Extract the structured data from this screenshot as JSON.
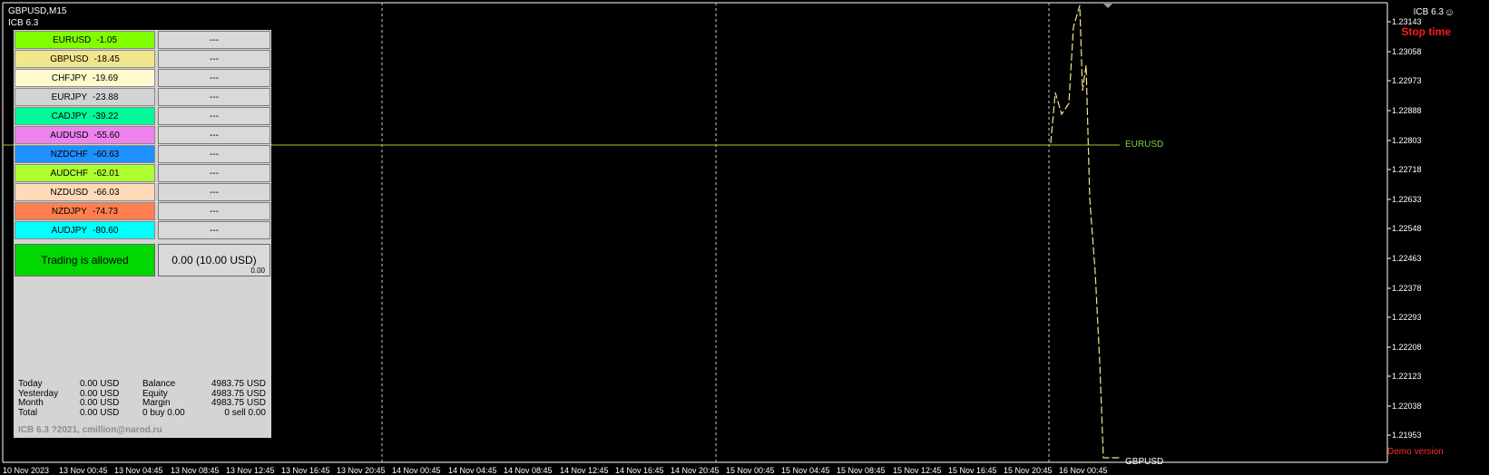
{
  "window": {
    "title": "GBPUSD,M15",
    "indicator": "ICB 6.3",
    "indicator_right": "ICB 6.3",
    "smile_icon": "smiley-icon"
  },
  "status": {
    "stop_time": "Stop time",
    "demo": "Demo version"
  },
  "pairs": [
    {
      "symbol": "EURUSD",
      "value": "-1.05",
      "color": "#80ff00",
      "action": "---"
    },
    {
      "symbol": "GBPUSD",
      "value": "-18.45",
      "color": "#f0e68c",
      "action": "---"
    },
    {
      "symbol": "CHFJPY",
      "value": "-19.69",
      "color": "#fffacd",
      "action": "---"
    },
    {
      "symbol": "EURJPY",
      "value": "-23.88",
      "color": "#d3d3d3",
      "action": "---"
    },
    {
      "symbol": "CADJPY",
      "value": "-39.22",
      "color": "#00fa9a",
      "action": "---"
    },
    {
      "symbol": "AUDUSD",
      "value": "-55.60",
      "color": "#ee82ee",
      "action": "---"
    },
    {
      "symbol": "NZDCHF",
      "value": "-60.63",
      "color": "#1e90ff",
      "action": "---"
    },
    {
      "symbol": "AUDCHF",
      "value": "-62.01",
      "color": "#adff2f",
      "action": "---"
    },
    {
      "symbol": "NZDUSD",
      "value": "-66.03",
      "color": "#ffdab9",
      "action": "---"
    },
    {
      "symbol": "NZDJPY",
      "value": "-74.73",
      "color": "#ff7f50",
      "action": "---"
    },
    {
      "symbol": "AUDJPY",
      "value": "-80.60",
      "color": "#00ffff",
      "action": "---"
    }
  ],
  "trading": {
    "status": "Trading is allowed",
    "profit": "0.00 (10.00 USD)",
    "profit_small": "0.00"
  },
  "stats": {
    "today_label": "Today",
    "today": "0.00 USD",
    "yesterday_label": "Yesterday",
    "yesterday": "0.00 USD",
    "month_label": "Month",
    "month": "0.00 USD",
    "total_label": "Total",
    "total": "0.00 USD",
    "balance_label": "Balance",
    "balance": "4983.75 USD",
    "equity_label": "Equity",
    "equity": "4983.75 USD",
    "margin_label": "Margin",
    "margin": "4983.75 USD",
    "buy": "0 buy 0.00",
    "sell": "0 sell 0.00"
  },
  "credit": "ICB 6.3 ?2021, cmillion@narod.ru",
  "price_labels": [
    "1.23143",
    "1.23058",
    "1.22973",
    "1.22888",
    "1.22803",
    "1.22718",
    "1.22633",
    "1.22548",
    "1.22463",
    "1.22378",
    "1.22293",
    "1.22208",
    "1.22123",
    "1.22038",
    "1.21953"
  ],
  "time_labels": [
    "10 Nov 2023",
    "13 Nov 00:45",
    "13 Nov 04:45",
    "13 Nov 08:45",
    "13 Nov 12:45",
    "13 Nov 16:45",
    "13 Nov 20:45",
    "14 Nov 00:45",
    "14 Nov 04:45",
    "14 Nov 08:45",
    "14 Nov 12:45",
    "14 Nov 16:45",
    "14 Nov 20:45",
    "15 Nov 00:45",
    "15 Nov 04:45",
    "15 Nov 08:45",
    "15 Nov 12:45",
    "15 Nov 16:45",
    "15 Nov 20:45",
    "16 Nov 00:45"
  ],
  "lines": {
    "eurusd": "EURUSD",
    "gbpusd": "GBPUSD",
    "eurusd_color": "#9acd32"
  }
}
